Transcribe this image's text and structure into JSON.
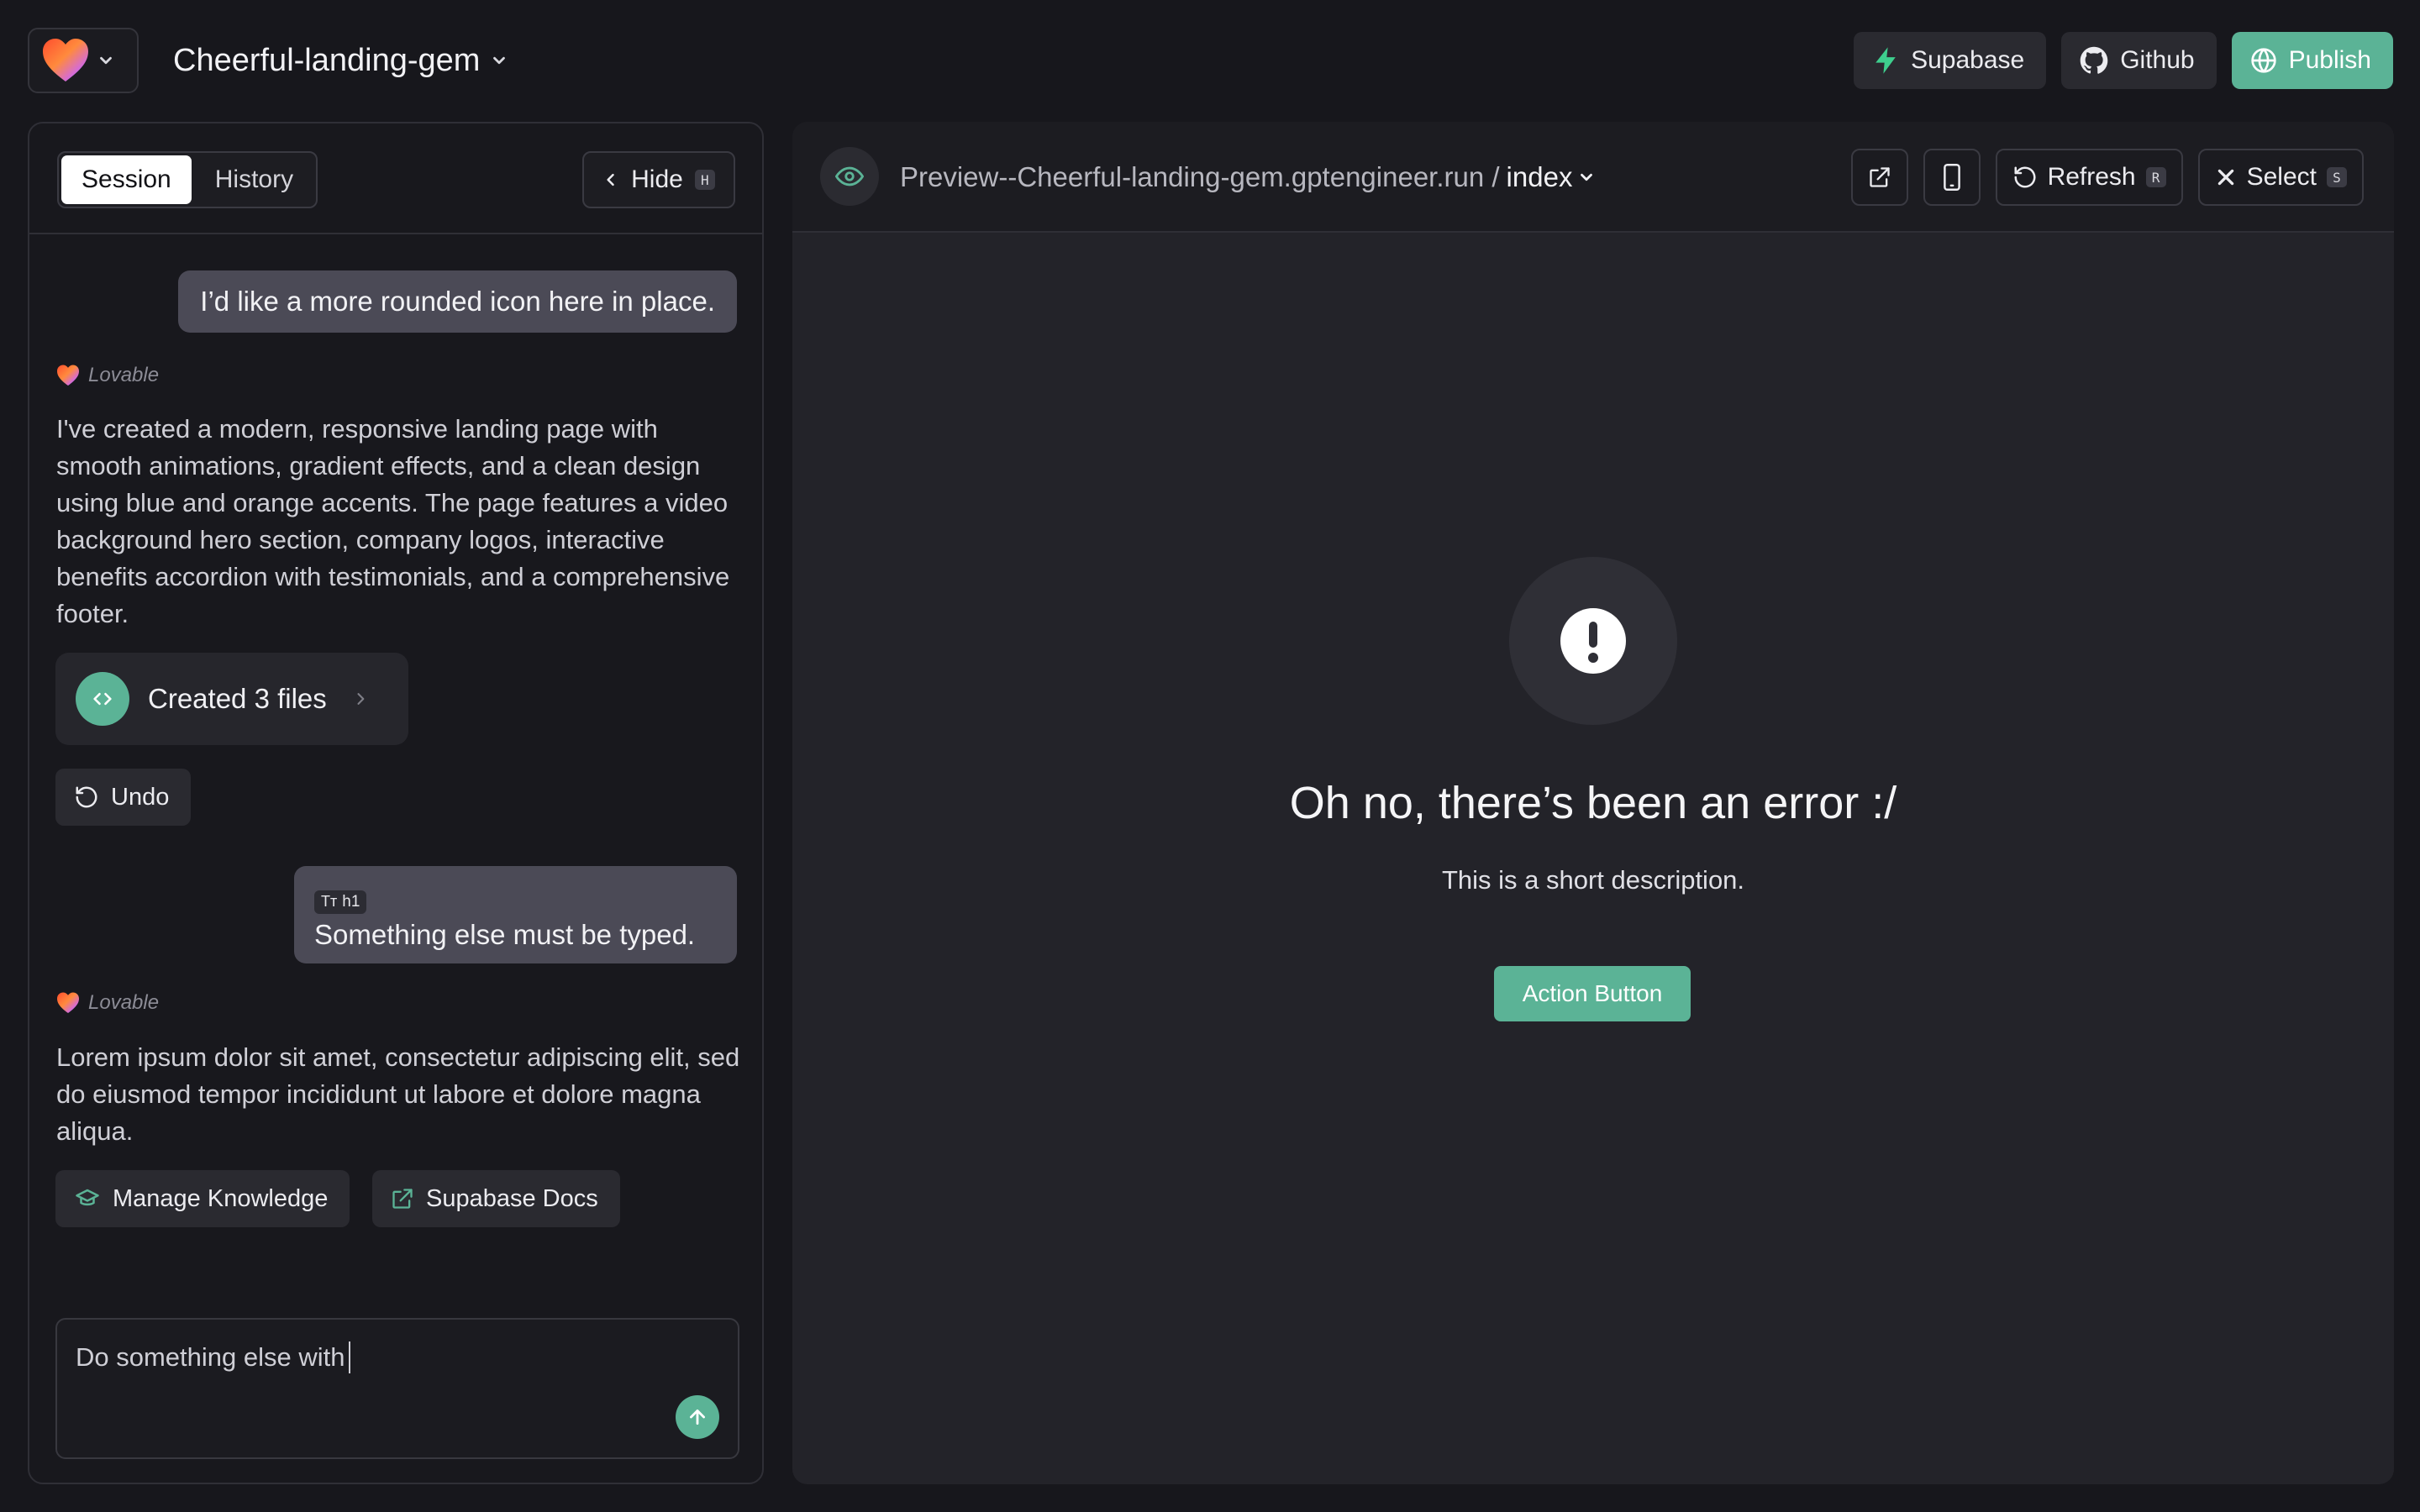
{
  "topbar": {
    "project_name": "Cheerful-landing-gem",
    "actions": {
      "supabase": "Supabase",
      "github": "Github",
      "publish": "Publish"
    }
  },
  "session": {
    "tabs": [
      "Session",
      "History"
    ],
    "hide_label": "Hide",
    "hide_shortcut": "H"
  },
  "chat": {
    "user_message_1": "I’d like a more rounded icon here in place.",
    "assistant_name": "Lovable",
    "assistant_message_1": "I've created a modern, responsive landing page with smooth animations, gradient effects, and a clean design using blue and orange accents. The  page features a video background hero section, company logos, interactive benefits accordion with testimonials, and a comprehensive footer.",
    "files_card": "Created 3 files",
    "undo": "Undo",
    "user_message_2_tag": "h1",
    "user_message_2": "Something else must be typed.",
    "assistant_message_2": "Lorem ipsum dolor sit amet, consectetur adipiscing elit, sed do eiusmod tempor incididunt ut labore et dolore magna aliqua.",
    "manage_knowledge": "Manage Knowledge",
    "supabase_docs": "Supabase Docs"
  },
  "prompt": {
    "value": "Do something else with"
  },
  "preview": {
    "url_prefix": "Preview--Cheerful-landing-gem.gptengineer.run /",
    "page": "index",
    "refresh_label": "Refresh",
    "refresh_shortcut": "R",
    "select_label": "Select",
    "select_shortcut": "S",
    "error_title": "Oh no, there’s been an error :/",
    "error_description": "This is a short description.",
    "action_button": "Action Button"
  },
  "colors": {
    "accent": "#5bb396",
    "background": "#17171c",
    "panel": "#232329"
  },
  "icons": [
    "heart-logo-icon",
    "chevron-down-icon",
    "bolt-icon",
    "github-icon",
    "globe-icon",
    "chevron-left-icon",
    "code-icon",
    "chevron-right-icon",
    "undo-icon",
    "text-icon",
    "graduation-cap-icon",
    "external-link-icon",
    "arrow-up-icon",
    "eye-icon",
    "mobile-icon",
    "refresh-icon",
    "close-icon",
    "exclamation-icon"
  ]
}
